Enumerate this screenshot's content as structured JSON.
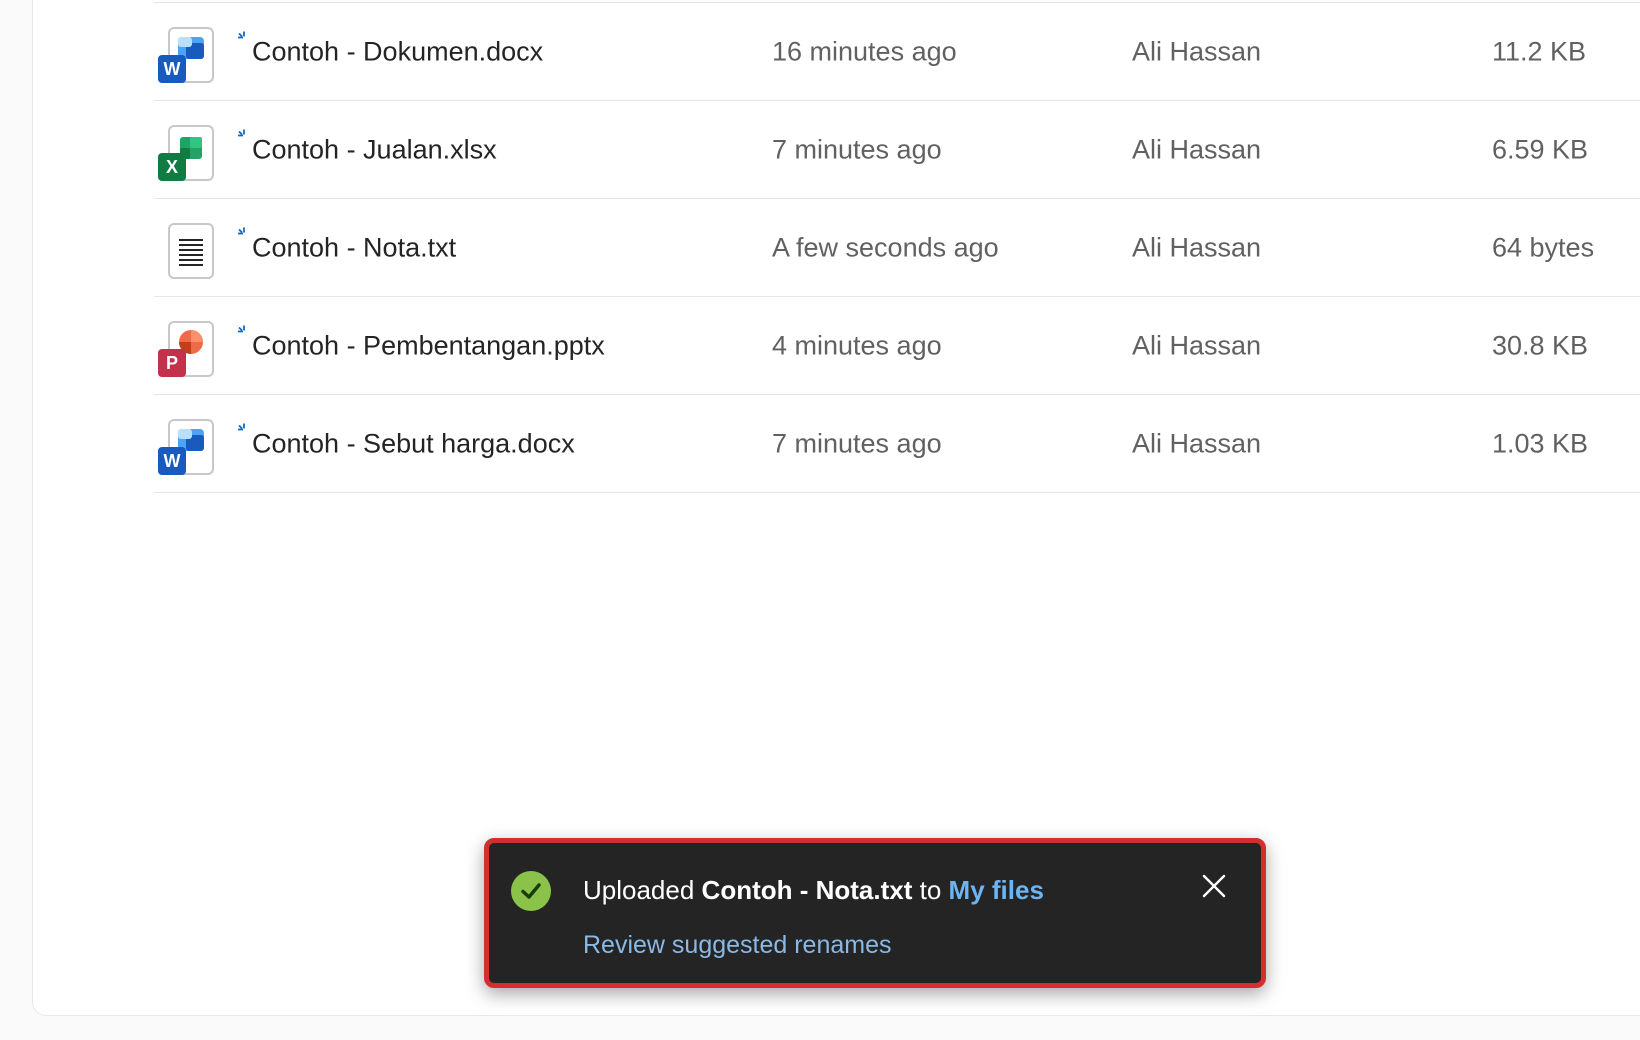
{
  "files": [
    {
      "name": "Contoh - Dokumen.docx",
      "modified": "16 minutes ago",
      "owner": "Ali Hassan",
      "size": "11.2 KB",
      "type": "word-icon"
    },
    {
      "name": "Contoh - Jualan.xlsx",
      "modified": "7 minutes ago",
      "owner": "Ali Hassan",
      "size": "6.59 KB",
      "type": "excel-icon"
    },
    {
      "name": "Contoh - Nota.txt",
      "modified": "A few seconds ago",
      "owner": "Ali Hassan",
      "size": "64 bytes",
      "type": "text-file-icon"
    },
    {
      "name": "Contoh - Pembentangan.pptx",
      "modified": "4 minutes ago",
      "owner": "Ali Hassan",
      "size": "30.8 KB",
      "type": "powerpoint-icon"
    },
    {
      "name": "Contoh - Sebut harga.docx",
      "modified": "7 minutes ago",
      "owner": "Ali Hassan",
      "size": "1.03 KB",
      "type": "word-icon"
    }
  ],
  "toast": {
    "prefix": "Uploaded",
    "file": "Contoh - Nota.txt",
    "middle": "to",
    "destination": "My files",
    "action": "Review suggested renames",
    "icon": "check-circle-icon",
    "close_icon": "close-icon"
  },
  "colors": {
    "toast_bg": "#242424",
    "toast_border": "#d32f2f",
    "success": "#8bc34a",
    "link": "#6cb4f2",
    "word": "#185abd",
    "excel": "#107c41",
    "powerpoint": "#c43e1c"
  }
}
